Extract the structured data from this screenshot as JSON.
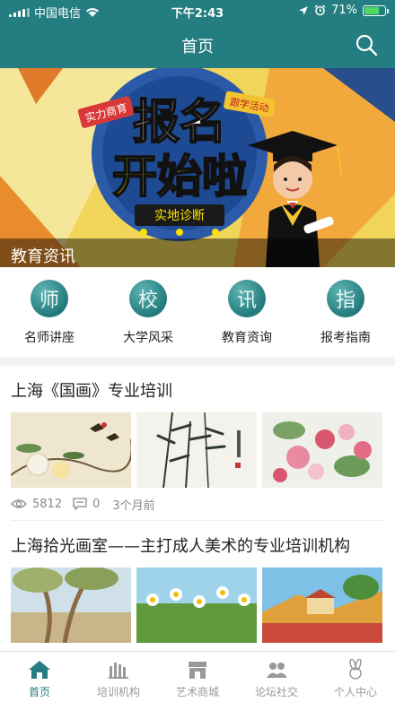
{
  "status_bar": {
    "carrier": "中国电信",
    "time": "下午2:43",
    "battery": "71%",
    "battery_level": 0.71
  },
  "header": {
    "title": "首页"
  },
  "banner": {
    "caption": "教育资讯",
    "headline_1": "报名",
    "headline_2": "开始啦",
    "badge_left": "实力商育",
    "badge_right": "跟学活动",
    "subline": "实地诊断"
  },
  "categories": [
    {
      "label": "名师讲座",
      "glyph": "师"
    },
    {
      "label": "大学风采",
      "glyph": "校"
    },
    {
      "label": "教育资询",
      "glyph": "讯"
    },
    {
      "label": "报考指南",
      "glyph": "指"
    }
  ],
  "articles": [
    {
      "title": "上海《国画》专业培训",
      "views": "5812",
      "comments": "0",
      "time": "3个月前"
    },
    {
      "title": "上海拾光画室——主打成人美术的专业培训机构"
    }
  ],
  "tabs": [
    {
      "label": "首页"
    },
    {
      "label": "培训机构"
    },
    {
      "label": "艺术商城"
    },
    {
      "label": "论坛社交"
    },
    {
      "label": "个人中心"
    }
  ],
  "colors": {
    "primary": "#247d80",
    "tab_inactive": "#999999"
  }
}
